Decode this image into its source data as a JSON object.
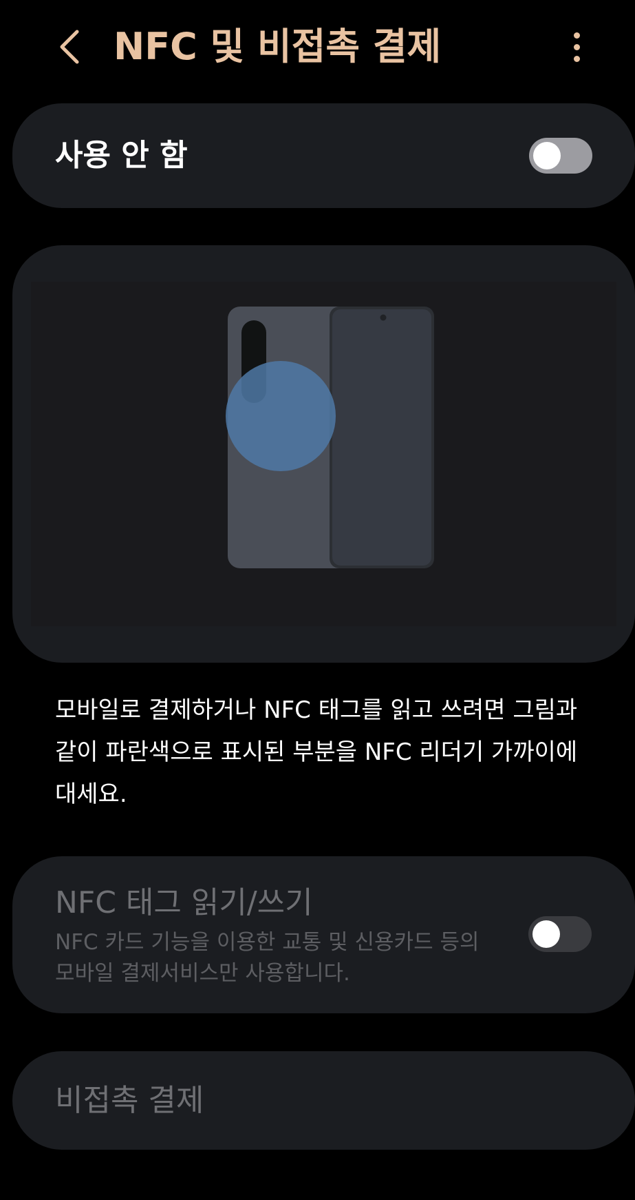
{
  "header": {
    "back_icon": "chevron-left-icon",
    "title": "NFC 및 비접촉 결제",
    "more_icon": "more-vertical-icon"
  },
  "master_switch": {
    "label": "사용 안 함",
    "state": "off"
  },
  "illustration": {
    "description_icon": "phone-nfc-area-illustration"
  },
  "description": "모바일로 결제하거나 NFC 태그를 읽고 쓰려면 그림과 같이 파란색으로 표시된 부분을 NFC 리더기 가까이에 대세요.",
  "nfc_tag": {
    "title": "NFC 태그 읽기/쓰기",
    "subtitle": "NFC 카드 기능을 이용한 교통 및 신용카드 등의 모바일 결제서비스만 사용합니다.",
    "state": "off",
    "enabled": false
  },
  "contactless_payment": {
    "label": "비접촉 결제",
    "enabled": false
  },
  "colors": {
    "background": "#000000",
    "card": "#1b1d21",
    "title_accent": "#e9c3a2",
    "toggle_off_track_enabled": "#9c9ca1",
    "toggle_off_track_disabled": "#3a3b3f",
    "disabled_text": "#6f7074",
    "nfc_highlight": "#4f79a6"
  }
}
